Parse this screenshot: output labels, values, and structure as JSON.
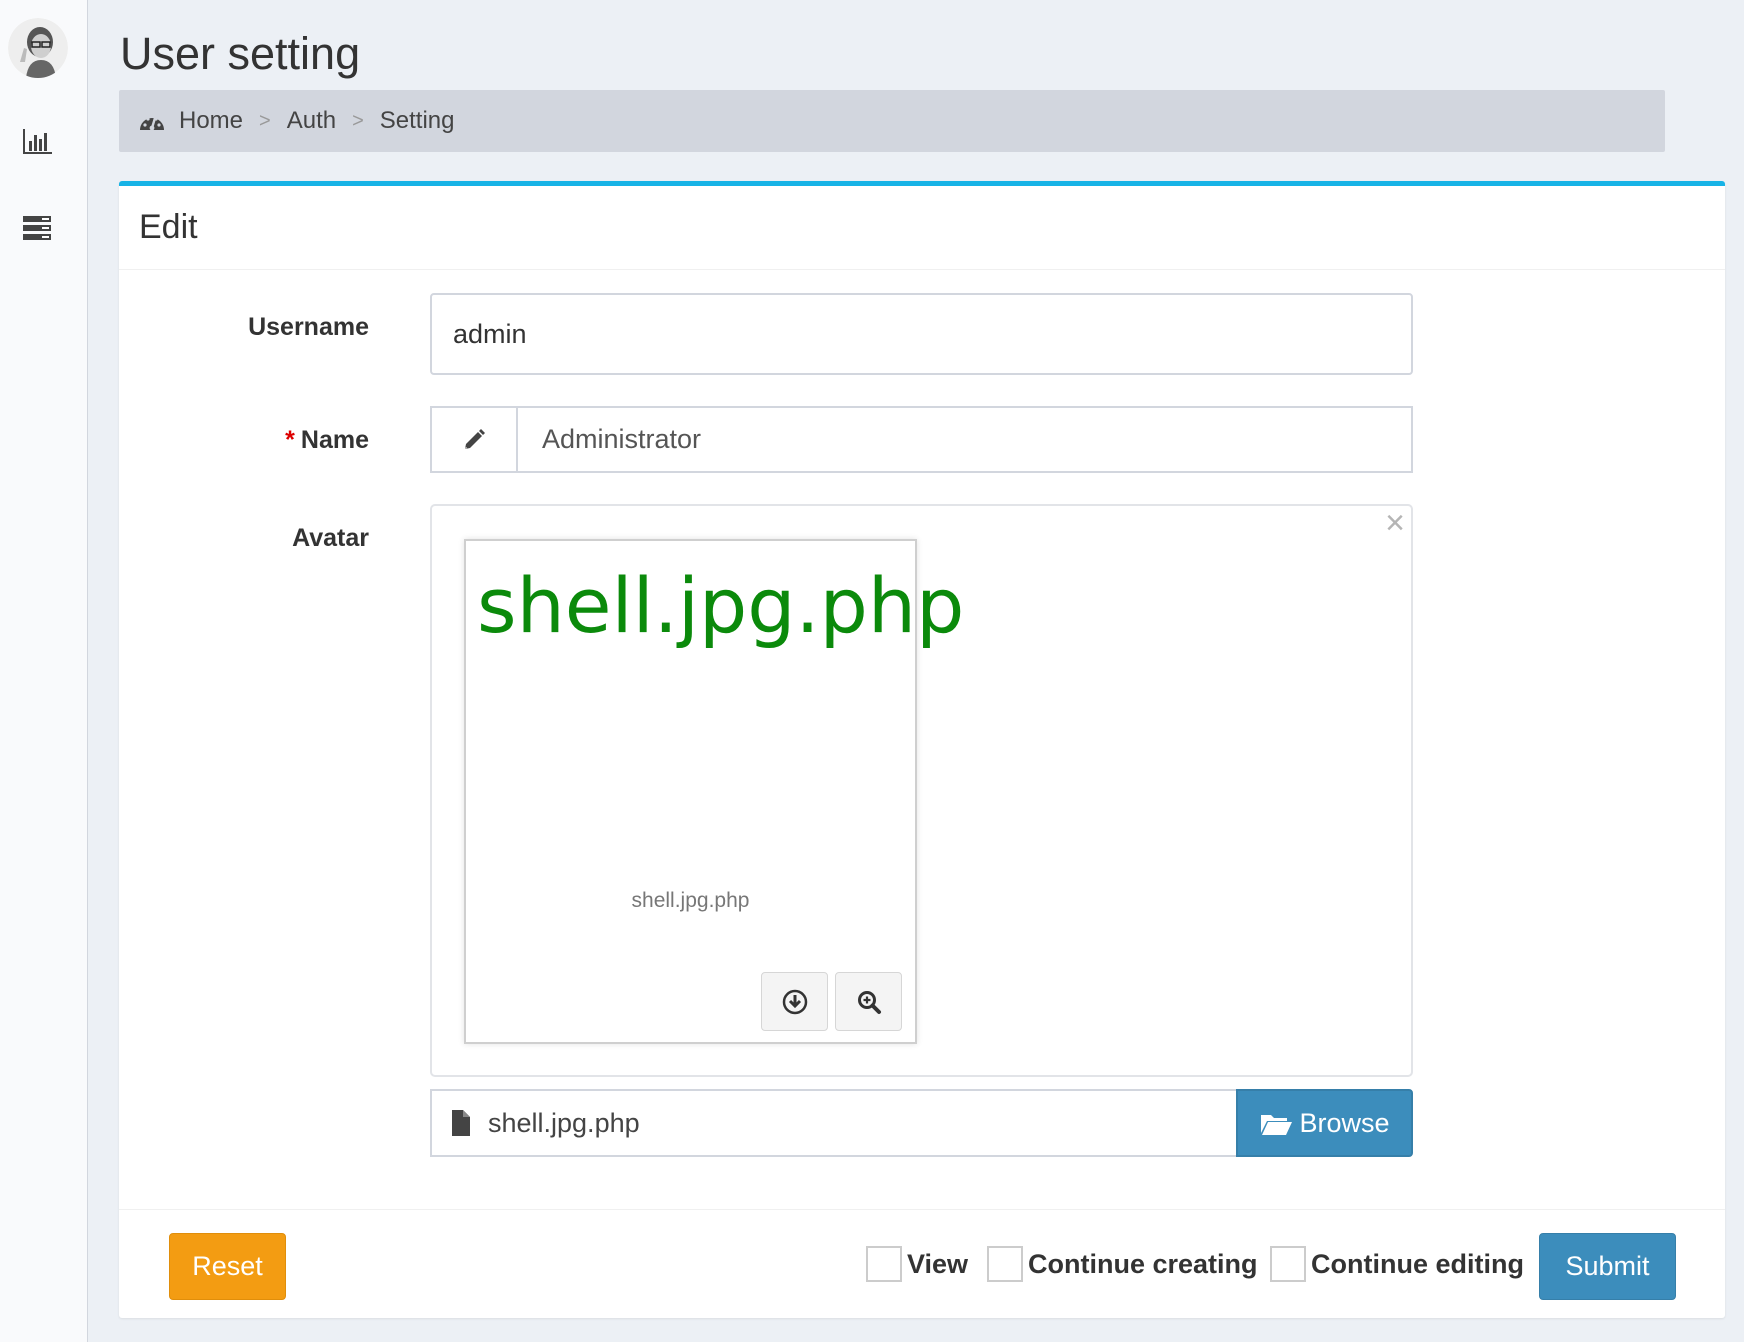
{
  "header": {
    "title": "User setting"
  },
  "breadcrumb": {
    "items": [
      "Home",
      "Auth",
      "Setting"
    ],
    "separator": ">"
  },
  "sidebar": {
    "icons": [
      "avatar",
      "bar-chart-icon",
      "list-icon"
    ]
  },
  "form": {
    "box_title": "Edit",
    "username": {
      "label": "Username",
      "value": "admin"
    },
    "name": {
      "label": "Name",
      "required_marker": "*",
      "value": "Administrator"
    },
    "avatar": {
      "label": "Avatar",
      "preview_text": "shell.jpg.php",
      "preview_caption": "shell.jpg.php",
      "file_name": "shell.jpg.php",
      "browse_label": "Browse",
      "close_symbol": "×"
    }
  },
  "footer": {
    "reset_label": "Reset",
    "checkboxes": [
      "View",
      "Continue creating",
      "Continue editing"
    ],
    "submit_label": "Submit"
  },
  "colors": {
    "box_accent": "#17b3e6",
    "primary": "#3c8dbc",
    "warning": "#f39c12",
    "preview_text": "#0b8a0b",
    "required": "#dd0000"
  }
}
